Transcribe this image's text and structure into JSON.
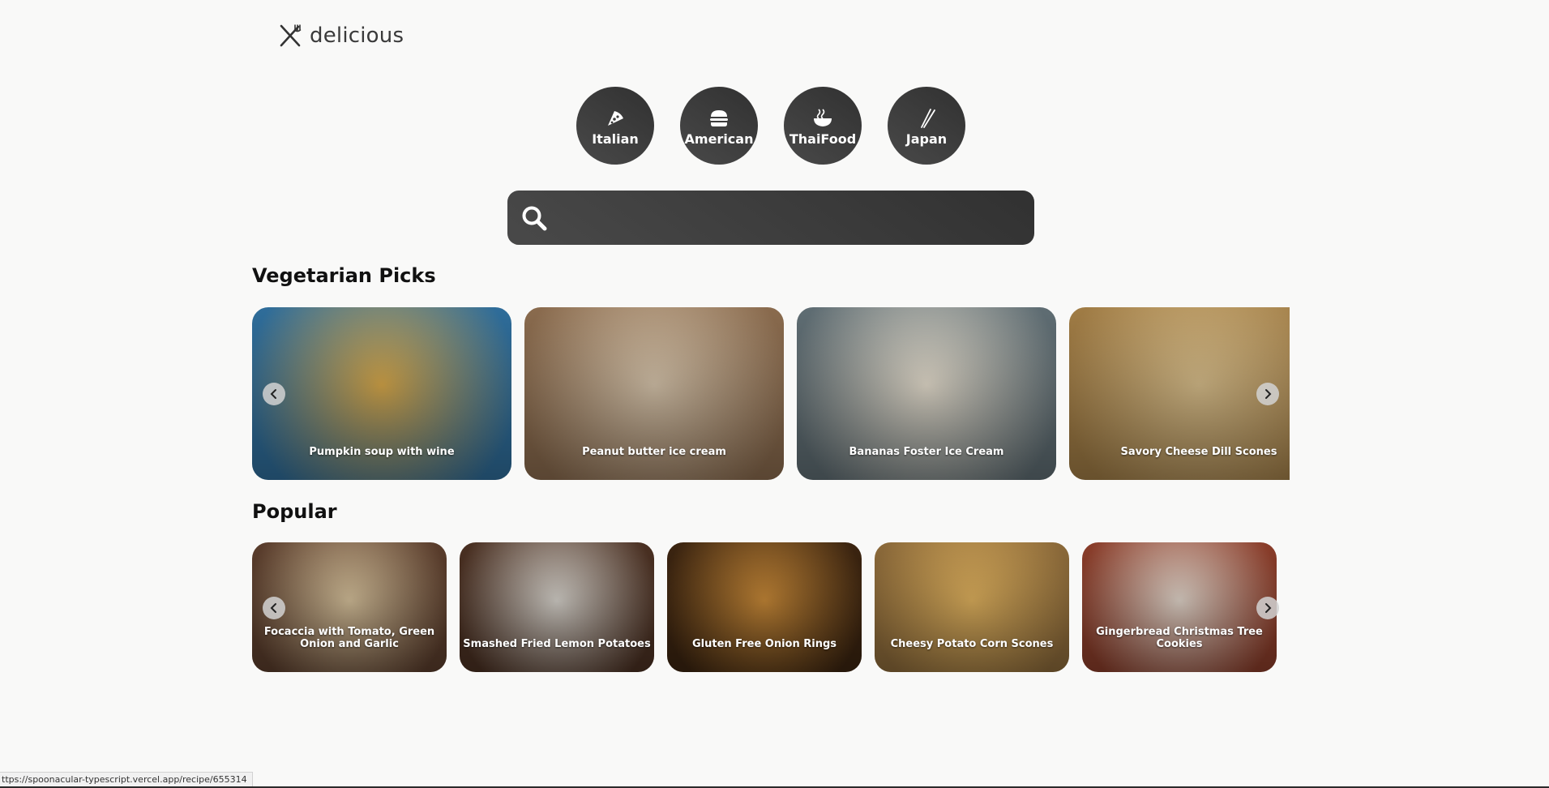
{
  "brand": {
    "name": "delicious",
    "icon": "fork-knife-icon"
  },
  "cuisines": [
    {
      "label": "Italian",
      "icon": "pizza-icon"
    },
    {
      "label": "American",
      "icon": "burger-icon"
    },
    {
      "label": "ThaiFood",
      "icon": "noodle-bowl-icon"
    },
    {
      "label": "Japan",
      "icon": "chopsticks-icon"
    }
  ],
  "search": {
    "icon": "search-icon",
    "value": "",
    "placeholder": ""
  },
  "vegetarian": {
    "title": "Vegetarian Picks",
    "cards": [
      {
        "title": "Pumpkin soup with wine",
        "colors": [
          "#2f6d9a",
          "#d9a94a"
        ]
      },
      {
        "title": "Peanut butter ice cream",
        "colors": [
          "#8a6b4e",
          "#d8c6ad"
        ]
      },
      {
        "title": "Bananas Foster Ice Cream",
        "colors": [
          "#5f6d73",
          "#e7dfcf"
        ]
      },
      {
        "title": "Savory Cheese Dill Scones",
        "colors": [
          "#a07c45",
          "#d9bf8c"
        ]
      }
    ]
  },
  "popular": {
    "title": "Popular",
    "cards": [
      {
        "title": "Focaccia with Tomato, Green Onion and Garlic",
        "colors": [
          "#5a3d2c",
          "#d7c29c"
        ]
      },
      {
        "title": "Smashed Fried Lemon Potatoes",
        "colors": [
          "#4a3022",
          "#d8d4cd"
        ]
      },
      {
        "title": "Gluten Free Onion Rings",
        "colors": [
          "#3b2410",
          "#c98a38"
        ]
      },
      {
        "title": "Cheesy Potato Corn Scones",
        "colors": [
          "#8c6a3a",
          "#e0b25e"
        ]
      },
      {
        "title": "Gingerbread Christmas Tree Cookies",
        "colors": [
          "#8a3d2a",
          "#e3d7cc"
        ]
      }
    ]
  },
  "status_url": "ttps://spoonacular-typescript.vercel.app/recipe/655314"
}
